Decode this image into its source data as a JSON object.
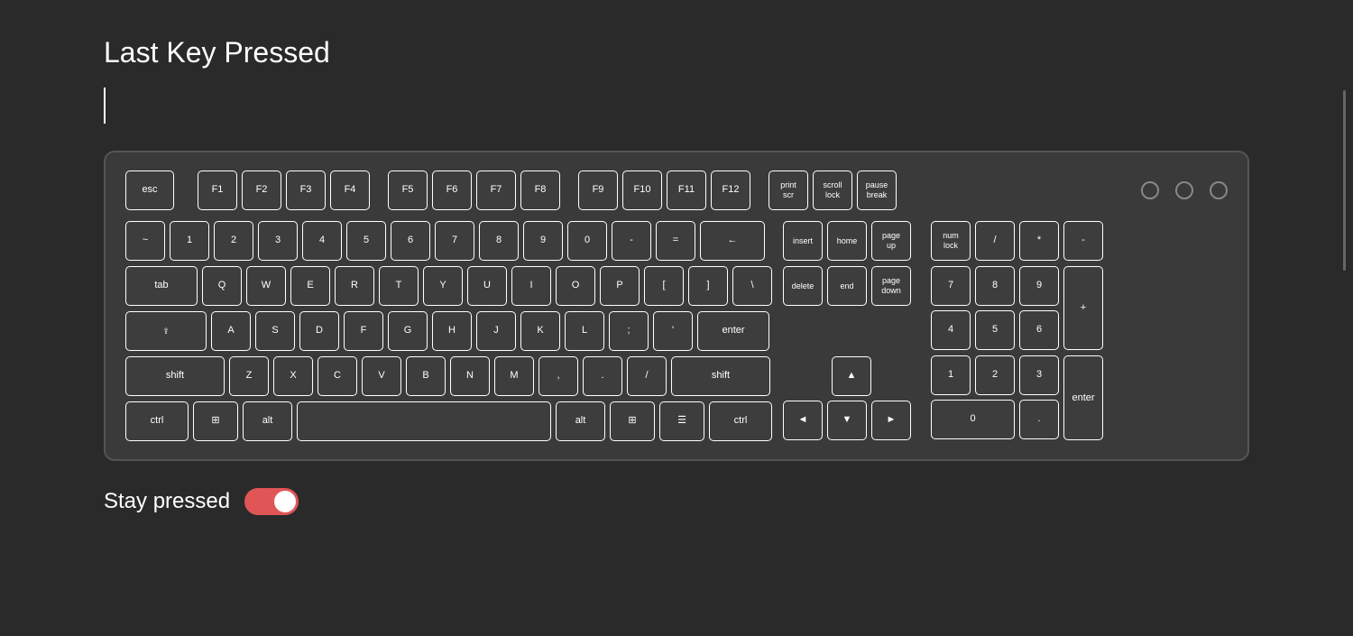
{
  "page": {
    "title": "Last Key Pressed",
    "background_color": "#2a2a2a"
  },
  "keyboard": {
    "rows": {
      "fn": [
        "esc",
        "F1",
        "F2",
        "F3",
        "F4",
        "F5",
        "F6",
        "F7",
        "F8",
        "F9",
        "F10",
        "F11",
        "F12",
        "print\nscr",
        "scroll\nlock",
        "pause\nbreak"
      ],
      "number": [
        "~",
        "1",
        "2",
        "3",
        "4",
        "5",
        "6",
        "7",
        "8",
        "9",
        "0",
        "-",
        "=",
        "←"
      ],
      "tab": [
        "tab",
        "Q",
        "W",
        "E",
        "R",
        "T",
        "Y",
        "U",
        "I",
        "O",
        "P",
        "[",
        "]",
        "\\"
      ],
      "caps": [
        "caps",
        "A",
        "S",
        "D",
        "F",
        "G",
        "H",
        "J",
        "K",
        "L",
        ";",
        "'",
        "enter"
      ],
      "shift": [
        "shift",
        "Z",
        "X",
        "C",
        "V",
        "B",
        "N",
        "M",
        ",",
        ".",
        "/",
        "shift"
      ],
      "ctrl": [
        "ctrl",
        "⊞",
        "alt",
        "",
        "alt",
        "⊞",
        "☰",
        "ctrl"
      ]
    },
    "nav": [
      "insert",
      "home",
      "page\nup",
      "delete",
      "end",
      "page\ndown"
    ],
    "arrows": [
      "▲",
      "◄",
      "▼",
      "►"
    ],
    "numpad": {
      "row1": [
        "num\nlock",
        "/",
        "*",
        "-"
      ],
      "row2": [
        "7",
        "8",
        "9"
      ],
      "row3": [
        "4",
        "5",
        "6",
        "+"
      ],
      "row4": [
        "1",
        "2",
        "3"
      ],
      "row5": [
        "0",
        "."
      ],
      "enter": "enter"
    }
  },
  "stay_pressed": {
    "label": "Stay pressed",
    "toggle_on": true
  }
}
